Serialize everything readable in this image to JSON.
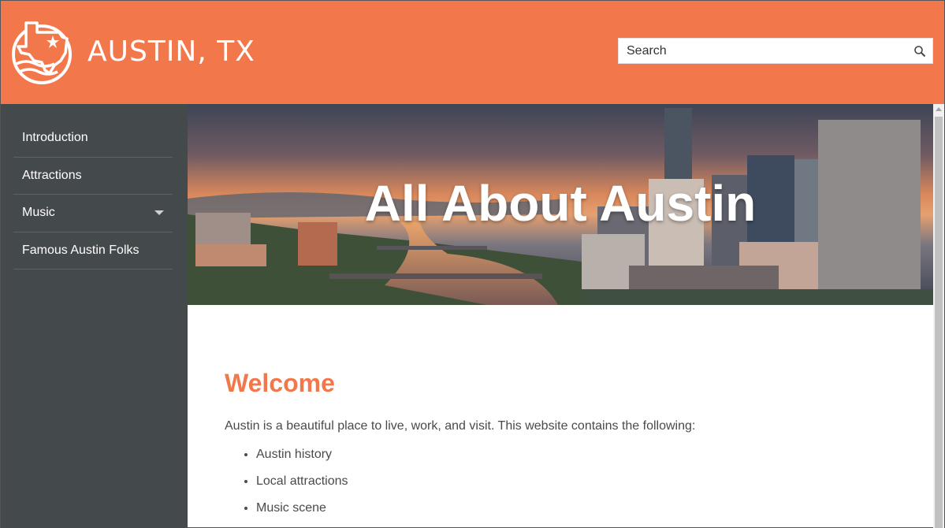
{
  "header": {
    "site_title": "AUSTIN, TX",
    "search": {
      "placeholder": "Search"
    },
    "brand_color": "#f2784b"
  },
  "sidebar": {
    "items": [
      {
        "label": "Introduction"
      },
      {
        "label": "Attractions"
      },
      {
        "label": "Music",
        "has_dropdown": true
      },
      {
        "label": "Famous Austin Folks"
      }
    ]
  },
  "hero": {
    "title": "All About Austin"
  },
  "main": {
    "heading": "Welcome",
    "intro": "Austin is a beautiful place to live, work, and visit. This website contains the following:",
    "features": [
      "Austin history",
      "Local attractions",
      "Music scene"
    ]
  }
}
